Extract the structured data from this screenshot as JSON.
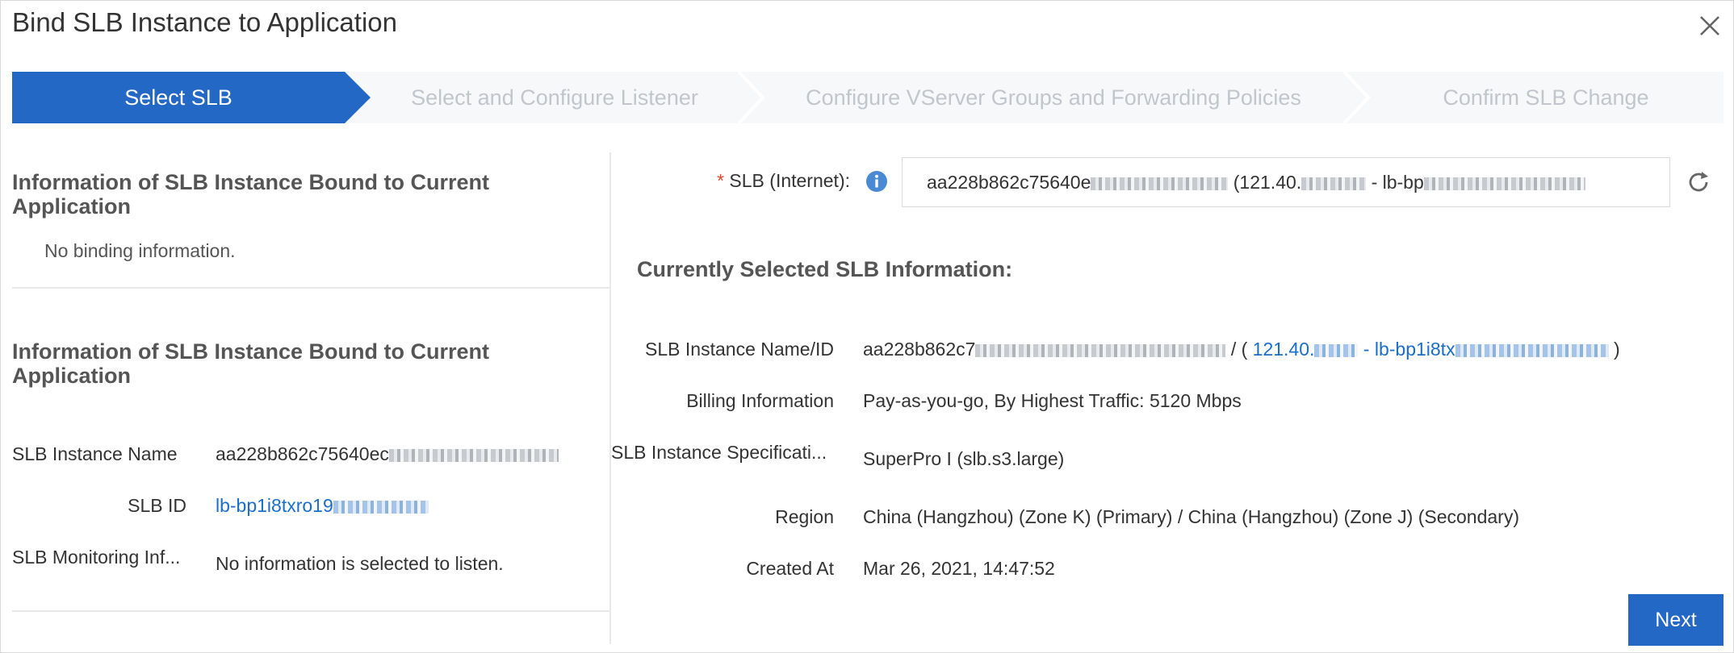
{
  "dialog": {
    "title": "Bind SLB Instance to Application"
  },
  "steps": [
    {
      "label": "Select SLB",
      "active": true
    },
    {
      "label": "Select and Configure Listener",
      "active": false
    },
    {
      "label": "Configure VServer Groups and Forwarding Policies",
      "active": false
    },
    {
      "label": "Confirm SLB Change",
      "active": false
    }
  ],
  "colors": {
    "accent": "#2468c5",
    "link": "#1a6ec8",
    "required": "#e0482d"
  },
  "left": {
    "section1": {
      "title": "Information of SLB Instance Bound to Current Application",
      "empty_text": "No binding information."
    },
    "section2": {
      "title": "Information of SLB Instance Bound to Current Application",
      "rows": [
        {
          "label": "SLB Instance Name",
          "value": "aa228b862c75640ec"
        },
        {
          "label": "SLB ID",
          "value": "lb-bp1i8txro19"
        },
        {
          "label": "SLB Monitoring Inf...",
          "value": "No information is selected to listen."
        }
      ]
    }
  },
  "right": {
    "slb_field": {
      "label": "SLB (Internet):",
      "value_prefix": "aa228b862c75640e",
      "value_mid": "(121.40.",
      "value_suffix": "- lb-bp"
    },
    "heading": "Currently Selected SLB Information:",
    "rows": [
      {
        "label": "SLB Instance Name/ID",
        "value": "aa228b862c7",
        "sep": "/ (",
        "link": "121.40.",
        "link2": "- lb-bp1i8tx",
        "close": ")"
      },
      {
        "label": "Billing Information",
        "value": "Pay-as-you-go, By Highest Traffic: 5120 Mbps"
      },
      {
        "label": "SLB Instance Specificati...",
        "value": "SuperPro I (slb.s3.large)"
      },
      {
        "label": "Region",
        "value": "China (Hangzhou) (Zone K) (Primary) / China (Hangzhou) (Zone J) (Secondary)"
      },
      {
        "label": "Created At",
        "value": "Mar 26, 2021, 14:47:52"
      }
    ],
    "next_label": "Next"
  },
  "icons": [
    "close-icon",
    "info-icon",
    "refresh-icon"
  ]
}
